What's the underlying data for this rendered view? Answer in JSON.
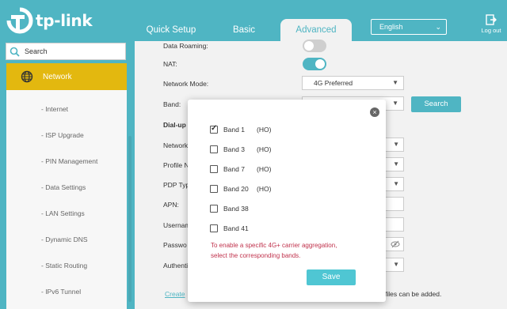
{
  "header": {
    "logo_text": "tp-link",
    "tabs": [
      {
        "label": "Quick Setup"
      },
      {
        "label": "Basic"
      },
      {
        "label": "Advanced"
      }
    ],
    "language": "English",
    "logout_label": "Log out"
  },
  "sidebar": {
    "search_placeholder": "Search",
    "active_section": "Network",
    "items": [
      {
        "label": "- Internet"
      },
      {
        "label": "- ISP Upgrade"
      },
      {
        "label": "- PIN Management"
      },
      {
        "label": "- Data Settings"
      },
      {
        "label": "- LAN Settings"
      },
      {
        "label": "- Dynamic DNS"
      },
      {
        "label": "- Static Routing"
      },
      {
        "label": "- IPv6 Tunnel"
      }
    ]
  },
  "main": {
    "data_roaming_label": "Data Roaming:",
    "nat_label": "NAT:",
    "network_mode_label": "Network Mode:",
    "network_mode_value": "4G Preferred",
    "band_label": "Band:",
    "search_button": "Search",
    "dialup_label": "Dial-up",
    "network_label": "Network",
    "profile_label": "Profile N",
    "pdp_label": "PDP Typ",
    "apn_label": "APN:",
    "username_label": "Usernam",
    "password_label": "Passwo",
    "auth_label": "Authenti",
    "create_link": "Create",
    "files_note": "files can be added."
  },
  "modal": {
    "bands": [
      {
        "name": "Band 1",
        "note": "(HO)",
        "checked": true
      },
      {
        "name": "Band 3",
        "note": "(HO)",
        "checked": false
      },
      {
        "name": "Band 7",
        "note": "(HO)",
        "checked": false
      },
      {
        "name": "Band 20",
        "note": "(HO)",
        "checked": false
      },
      {
        "name": "Band 38",
        "note": "",
        "checked": false
      },
      {
        "name": "Band 41",
        "note": "",
        "checked": false
      }
    ],
    "note_line1": "To enable a specific 4G+ carrier aggregation,",
    "note_line2": "select the corresponding bands.",
    "save_button": "Save"
  }
}
